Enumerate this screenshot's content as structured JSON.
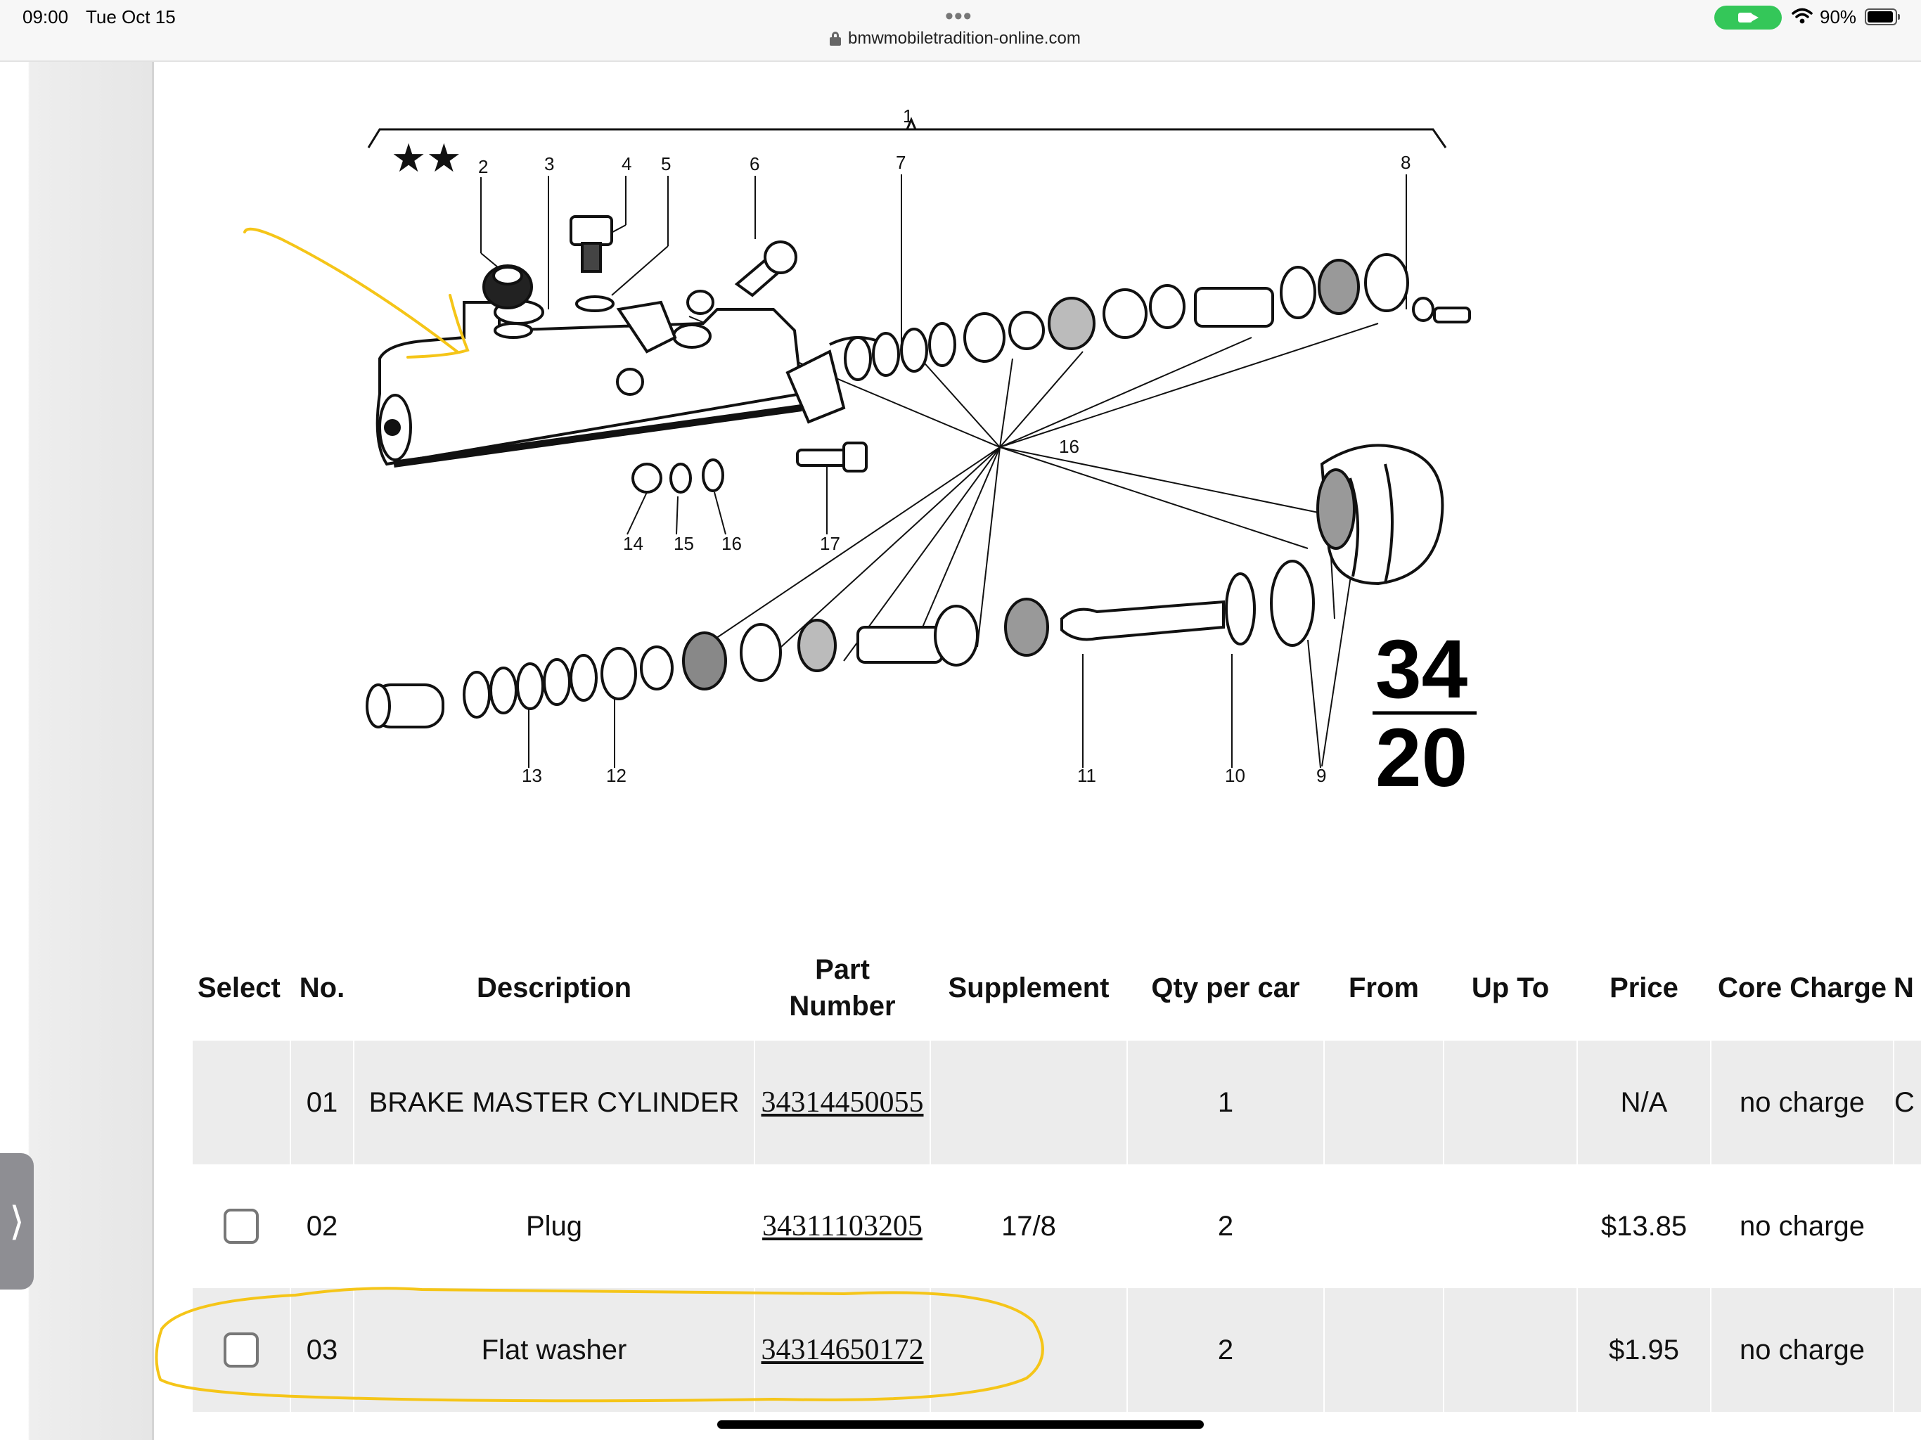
{
  "status_bar": {
    "time": "09:00",
    "date": "Tue Oct 15",
    "url": "bmwmobiletradition-online.com",
    "battery": "90%",
    "accent_green": "#34c759"
  },
  "diagram": {
    "callouts": [
      "1",
      "2",
      "3",
      "4",
      "5",
      "6",
      "7",
      "8",
      "9",
      "10",
      "11",
      "12",
      "13",
      "14",
      "15",
      "16",
      "16",
      "17"
    ],
    "fraction_top": "34",
    "fraction_bottom": "20",
    "annotation_color": "#f5c518"
  },
  "table": {
    "headers": {
      "select": "Select",
      "no": "No.",
      "description": "Description",
      "part_line1": "Part",
      "part_line2": "Number",
      "supplement": "Supplement",
      "qty": "Qty per car",
      "from": "From",
      "up_to": "Up To",
      "price": "Price",
      "core": "Core Charge",
      "next": "N"
    },
    "rows": [
      {
        "no": "01",
        "description": "BRAKE MASTER CYLINDER",
        "part": "34314450055",
        "supplement": "",
        "qty": "1",
        "from": "",
        "up_to": "",
        "price": "N/A",
        "core": "no charge",
        "next": "C",
        "has_checkbox": false
      },
      {
        "no": "02",
        "description": "Plug",
        "part": "34311103205",
        "supplement": "17/8",
        "qty": "2",
        "from": "",
        "up_to": "",
        "price": "$13.85",
        "core": "no charge",
        "next": "",
        "has_checkbox": true
      },
      {
        "no": "03",
        "description": "Flat washer",
        "part": "34314650172",
        "supplement": "",
        "qty": "2",
        "from": "",
        "up_to": "",
        "price": "$1.95",
        "core": "no charge",
        "next": "",
        "has_checkbox": true
      }
    ]
  }
}
